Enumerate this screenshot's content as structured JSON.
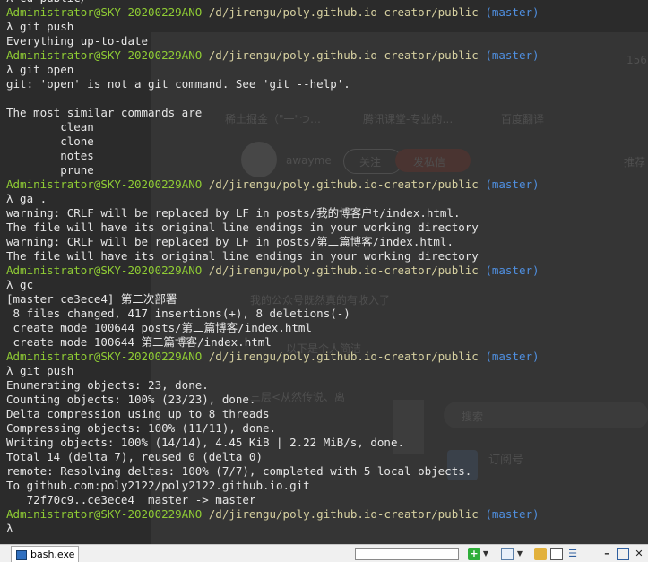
{
  "terminal": {
    "lines": [
      [
        {
          "t": "λ cd public/",
          "c": "plain"
        }
      ],
      [
        {
          "t": "Administrator@SKY-20200229ANO",
          "c": "user"
        },
        {
          "t": " /d/jirengu/poly.github.io-creator/public ",
          "c": "path"
        },
        {
          "t": "(master)",
          "c": "branch"
        }
      ],
      [
        {
          "t": "λ git push",
          "c": "plain"
        }
      ],
      [
        {
          "t": "Everything up-to-date",
          "c": "plain"
        }
      ],
      [
        {
          "t": "Administrator@SKY-20200229ANO",
          "c": "user"
        },
        {
          "t": " /d/jirengu/poly.github.io-creator/public ",
          "c": "path"
        },
        {
          "t": "(master)",
          "c": "branch"
        }
      ],
      [
        {
          "t": "λ git open",
          "c": "plain"
        }
      ],
      [
        {
          "t": "git: 'open' is not a git command. See 'git --help'.",
          "c": "plain"
        }
      ],
      [
        {
          "t": "",
          "c": "plain"
        }
      ],
      [
        {
          "t": "The most similar commands are",
          "c": "plain"
        }
      ],
      [
        {
          "t": "        clean",
          "c": "plain"
        }
      ],
      [
        {
          "t": "        clone",
          "c": "plain"
        }
      ],
      [
        {
          "t": "        notes",
          "c": "plain"
        }
      ],
      [
        {
          "t": "        prune",
          "c": "plain"
        }
      ],
      [
        {
          "t": "Administrator@SKY-20200229ANO",
          "c": "user"
        },
        {
          "t": " /d/jirengu/poly.github.io-creator/public ",
          "c": "path"
        },
        {
          "t": "(master)",
          "c": "branch"
        }
      ],
      [
        {
          "t": "λ ga .",
          "c": "plain"
        }
      ],
      [
        {
          "t": "warning: CRLF will be replaced by LF in posts/我的博客户t/index.html.",
          "c": "plain"
        }
      ],
      [
        {
          "t": "The file will have its original line endings in your working directory",
          "c": "plain"
        }
      ],
      [
        {
          "t": "warning: CRLF will be replaced by LF in posts/第二篇博客/index.html.",
          "c": "plain"
        }
      ],
      [
        {
          "t": "The file will have its original line endings in your working directory",
          "c": "plain"
        }
      ],
      [
        {
          "t": "Administrator@SKY-20200229ANO",
          "c": "user"
        },
        {
          "t": " /d/jirengu/poly.github.io-creator/public ",
          "c": "path"
        },
        {
          "t": "(master)",
          "c": "branch"
        }
      ],
      [
        {
          "t": "λ gc",
          "c": "plain"
        }
      ],
      [
        {
          "t": "[master ce3ece4] 第二次部署",
          "c": "plain"
        }
      ],
      [
        {
          "t": " 8 files changed, 417 insertions(+), 8 deletions(-)",
          "c": "plain"
        }
      ],
      [
        {
          "t": " create mode 100644 posts/第二篇博客/index.html",
          "c": "plain"
        }
      ],
      [
        {
          "t": " create mode 100644 第二篇博客/index.html",
          "c": "plain"
        }
      ],
      [
        {
          "t": "Administrator@SKY-20200229ANO",
          "c": "user"
        },
        {
          "t": " /d/jirengu/poly.github.io-creator/public ",
          "c": "path"
        },
        {
          "t": "(master)",
          "c": "branch"
        }
      ],
      [
        {
          "t": "λ git push",
          "c": "plain"
        }
      ],
      [
        {
          "t": "Enumerating objects: 23, done.",
          "c": "plain"
        }
      ],
      [
        {
          "t": "Counting objects: 100% (23/23), done.",
          "c": "plain"
        }
      ],
      [
        {
          "t": "Delta compression using up to 8 threads",
          "c": "plain"
        }
      ],
      [
        {
          "t": "Compressing objects: 100% (11/11), done.",
          "c": "plain"
        }
      ],
      [
        {
          "t": "Writing objects: 100% (14/14), 4.45 KiB | 2.22 MiB/s, done.",
          "c": "plain"
        }
      ],
      [
        {
          "t": "Total 14 (delta 7), reused 0 (delta 0)",
          "c": "plain"
        }
      ],
      [
        {
          "t": "remote: Resolving deltas: 100% (7/7), completed with 5 local objects.",
          "c": "plain"
        }
      ],
      [
        {
          "t": "To github.com:poly2122/poly2122.github.io.git",
          "c": "plain"
        }
      ],
      [
        {
          "t": "   72f70c9..ce3ece4  master -> master",
          "c": "plain"
        }
      ],
      [
        {
          "t": "Administrator@SKY-20200229ANO",
          "c": "user"
        },
        {
          "t": " /d/jirengu/poly.github.io-creator/public ",
          "c": "path"
        },
        {
          "t": "(master)",
          "c": "branch"
        }
      ],
      [
        {
          "t": "λ",
          "c": "plain"
        }
      ]
    ]
  },
  "background": {
    "bookmark_1": "稀土掘金（\"一\"つ…",
    "bookmark_2": "腾讯课堂-专业的…",
    "bookmark_3": "百度翻译",
    "author_name": "awayme",
    "follow_label": "关注",
    "chat_label": "发私信",
    "article_1": "我的公众号既然真的有收入了",
    "article_2": "以下是个人简洁",
    "article_3": "三层<从然传说、离",
    "rss_label": "订阅号",
    "search_hint": "搜索",
    "side_text": "推荐",
    "corner_num": "156"
  },
  "taskbar": {
    "tab_label": "bash.exe",
    "search_value": ""
  }
}
